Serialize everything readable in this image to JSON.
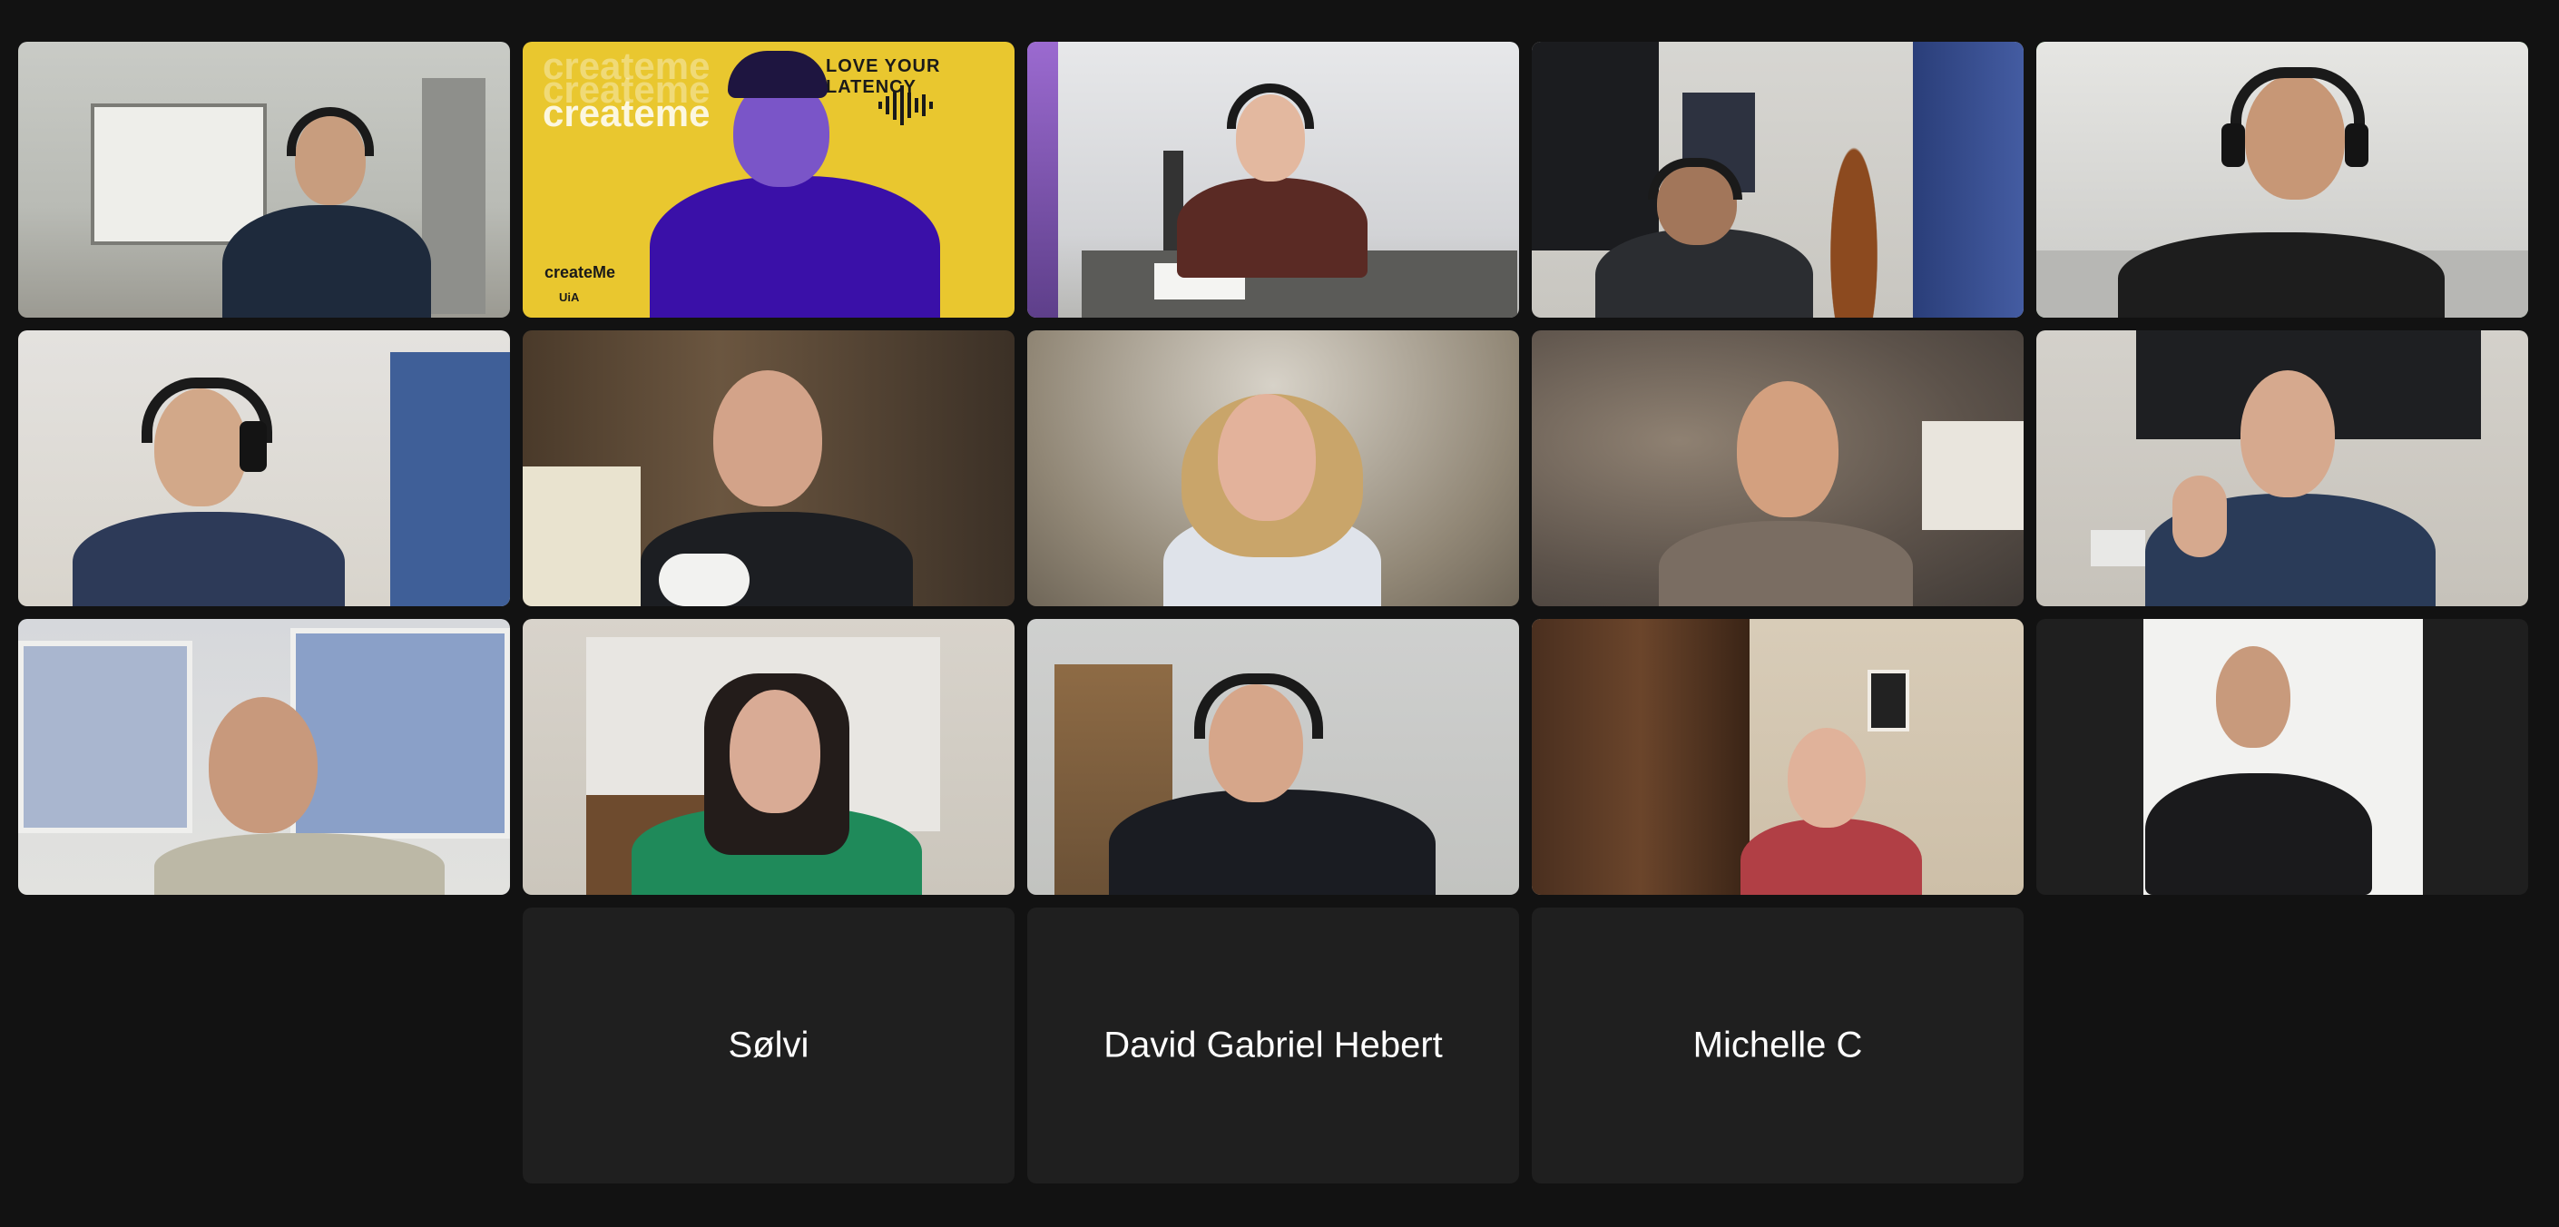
{
  "meeting": {
    "banner": {
      "text": "LOVE YOUR LATENCY",
      "brand_big": "createme",
      "brand_small": "createMe",
      "org": "UiA",
      "color": "#e9c72f"
    },
    "active_speaker_color": "#3fd24a",
    "participants_without_video": [
      {
        "name": "Sølvi"
      },
      {
        "name": "David Gabriel Hebert"
      },
      {
        "name": "Michelle C"
      }
    ]
  }
}
